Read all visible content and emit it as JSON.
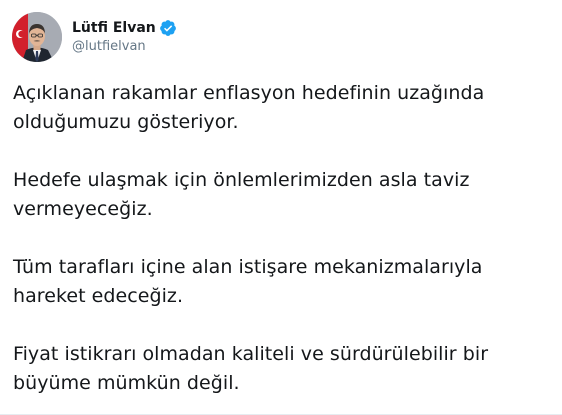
{
  "author": {
    "display_name": "Lütfi Elvan",
    "handle": "@lutfielvan",
    "verified": true,
    "avatar_icon": "portrait-photo",
    "verified_icon": "verified-badge-icon",
    "verified_color": "#1da1f2"
  },
  "tweet": {
    "paragraphs": [
      {
        "lines": [
          "Açıklanan rakamlar enflasyon hedefinin uzağında",
          "olduğumuzu gösteriyor."
        ]
      },
      {
        "lines": [
          "Hedefe ulaşmak için önlemlerimizden asla taviz",
          "vermeyeceğiz."
        ]
      },
      {
        "lines": [
          "Tüm tarafları içine alan istişare mekanizmalarıyla",
          "hareket edeceğiz."
        ]
      },
      {
        "lines": [
          "Fiyat istikrarı olmadan kaliteli ve sürdürülebilir bir",
          "büyüme mümkün değil."
        ]
      }
    ]
  }
}
